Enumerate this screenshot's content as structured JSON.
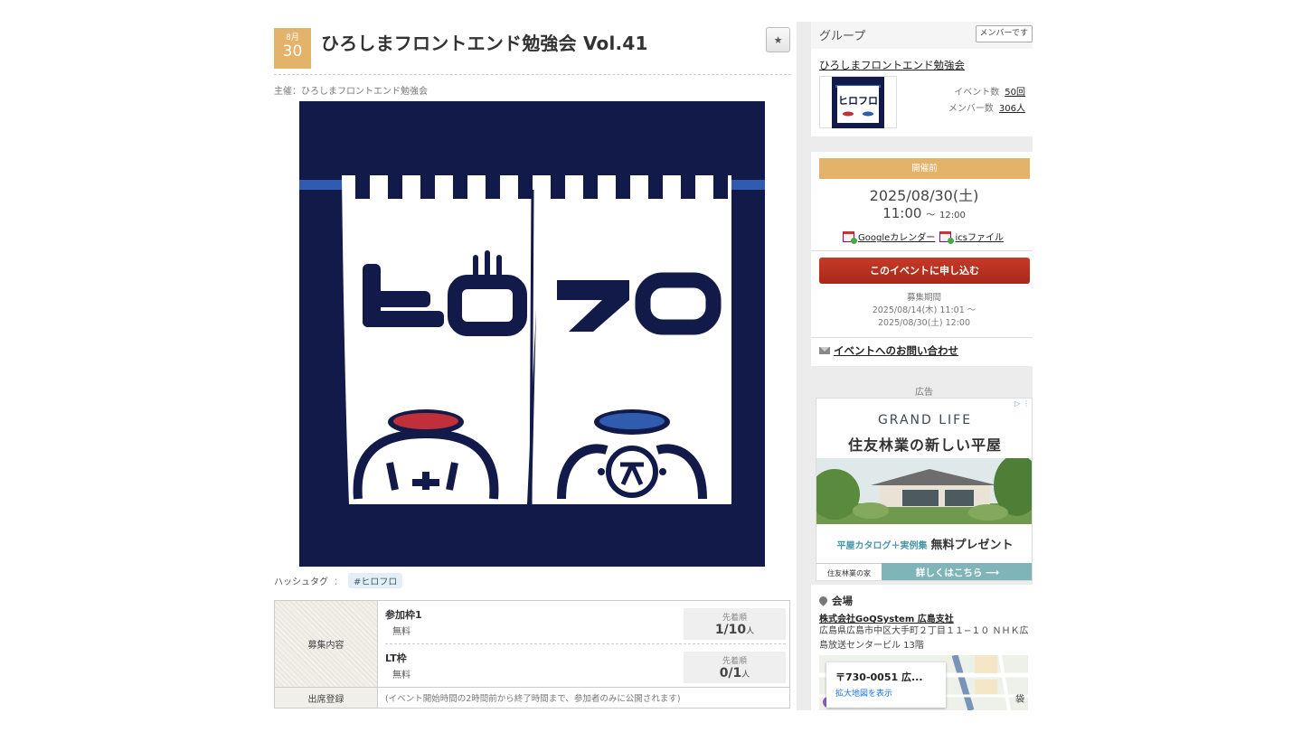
{
  "event": {
    "month": "8月",
    "day": "30",
    "title": "ひろしまフロントエンド勉強会 Vol.41",
    "star_icon": "star-icon",
    "organizer": "主催：ひろしまフロントエンド勉強会",
    "banner_text": [
      "ヒロフロ"
    ],
    "hashtag_label": "ハッシュタグ",
    "hashtag_colon": "：",
    "hashtag": "#ヒロフロ"
  },
  "recruitment": {
    "label": "募集内容",
    "slots": [
      {
        "name": "参加枠1",
        "fee": "無料",
        "order": "先着順",
        "count": "1/10",
        "unit": "人"
      },
      {
        "name": "LT枠",
        "fee": "無料",
        "order": "先着順",
        "count": "0/1",
        "unit": "人"
      }
    ],
    "attendance_label": "出席登録",
    "attendance_note": "(イベント開始時間の2時間前から終了時間まで、参加者のみに公開されます)"
  },
  "group": {
    "heading": "グループ",
    "member_button": "メンバーです",
    "name": "ひろしまフロントエンド勉強会",
    "events_label": "イベント数",
    "events_value": "50回",
    "members_label": "メンバー数",
    "members_value": "306人"
  },
  "schedule": {
    "status": "開催前",
    "date": "2025/08/30(土)",
    "start": "11:00",
    "tilde": "～",
    "end": "12:00",
    "google_cal": "Googleカレンダー",
    "ics": "icsファイル",
    "apply_button": "このイベントに申し込む",
    "period_label": "募集期間",
    "period_start": "2025/08/14(木) 11:01 ～",
    "period_end": "2025/08/30(土) 12:00",
    "contact": "イベントへのお問い合わせ"
  },
  "ad": {
    "label": "広告",
    "headline1": "GRAND LIFE",
    "headline2": "住友林業の新しい平屋",
    "offer_a": "平屋カタログ＋実例集",
    "offer_b": "無料プレゼント",
    "brand": "住友林業の家",
    "cta": "詳しくはこちら ⟶",
    "adchoice": "▷ ⋮"
  },
  "venue": {
    "heading": "会場",
    "name": "株式会社GoQSystem 広島支社",
    "address": "広島県広島市中区大手町２丁目１１−１０ ＮＨＫ広島放送センタービル 13階",
    "map_postal": "〒730-0051 広...",
    "map_link": "拡大地図を表示",
    "map_label": "袋"
  },
  "colors": {
    "badge": "#e3b36a",
    "apply": "#b3301f",
    "banner_navy": "#121a4a",
    "banner_stripe": "#2f5cae"
  }
}
